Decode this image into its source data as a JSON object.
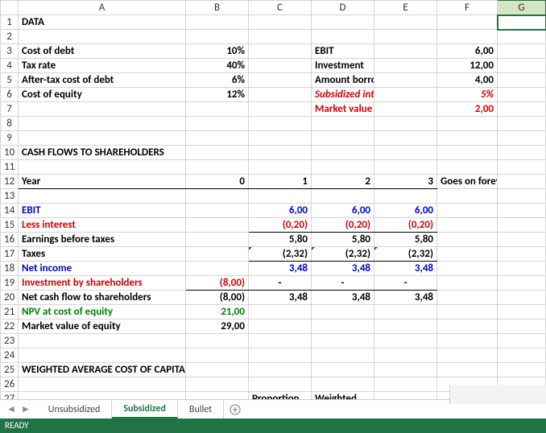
{
  "columns": [
    "A",
    "B",
    "C",
    "D",
    "E",
    "F",
    "G"
  ],
  "rows": [
    "1",
    "2",
    "3",
    "4",
    "5",
    "6",
    "7",
    "8",
    "9",
    "10",
    "11",
    "12",
    "13",
    "14",
    "15",
    "16",
    "17",
    "18",
    "19",
    "20",
    "21",
    "22",
    "23",
    "24",
    "25",
    "26",
    "27"
  ],
  "selected_col": "G",
  "labels": {
    "data": "DATA",
    "cost_of_debt": "Cost of debt",
    "tax_rate": "Tax rate",
    "after_tax_cost": "After-tax cost of debt",
    "cost_of_equity": "Cost of equity",
    "ebit": "EBIT",
    "investment": "Investment",
    "amount_borrowed": "Amount borrowed",
    "sub_rate": "Subsidized interest rate",
    "mv_debt": "Market value of debt",
    "cfsh": "CASH FLOWS TO SHAREHOLDERS",
    "year": "Year",
    "goes": "Goes on forever",
    "less_int": "Less interest",
    "ebt": "Earnings before taxes",
    "taxes": "Taxes",
    "net_income": "Net income",
    "inv_sh": "Investment by shareholders",
    "ncf": "Net cash flow to shareholders",
    "npv": "NPV at cost of equity",
    "mv_eq": "Market value of equity",
    "wacc": "WEIGHTED AVERAGE COST OF CAPITAL",
    "proportion": "Proportion",
    "weighted": "Weighted"
  },
  "vals": {
    "cost_of_debt": "10%",
    "tax_rate": "40%",
    "after_tax_cost": "6%",
    "cost_of_equity": "12%",
    "ebit": "6,00",
    "investment": "12,00",
    "amount_borrowed": "4,00",
    "sub_rate": "5%",
    "mv_debt": "2,00",
    "y0": "0",
    "y1": "1",
    "y2": "2",
    "y3": "3",
    "ebit_c": "6,00",
    "less_int": "(0,20)",
    "ebt_c": "5,80",
    "taxes_c": "(2,32)",
    "ni_c": "3,48",
    "inv_sh": "(8,00)",
    "dash": "-",
    "ncf0": "(8,00)",
    "ncf_c": "3,48",
    "npv": "21,00",
    "mv_eq": "29,00"
  },
  "tabs": {
    "t1": "Unsubsidized",
    "t2": "Subsidized",
    "t3": "Bullet"
  },
  "status": "READY"
}
